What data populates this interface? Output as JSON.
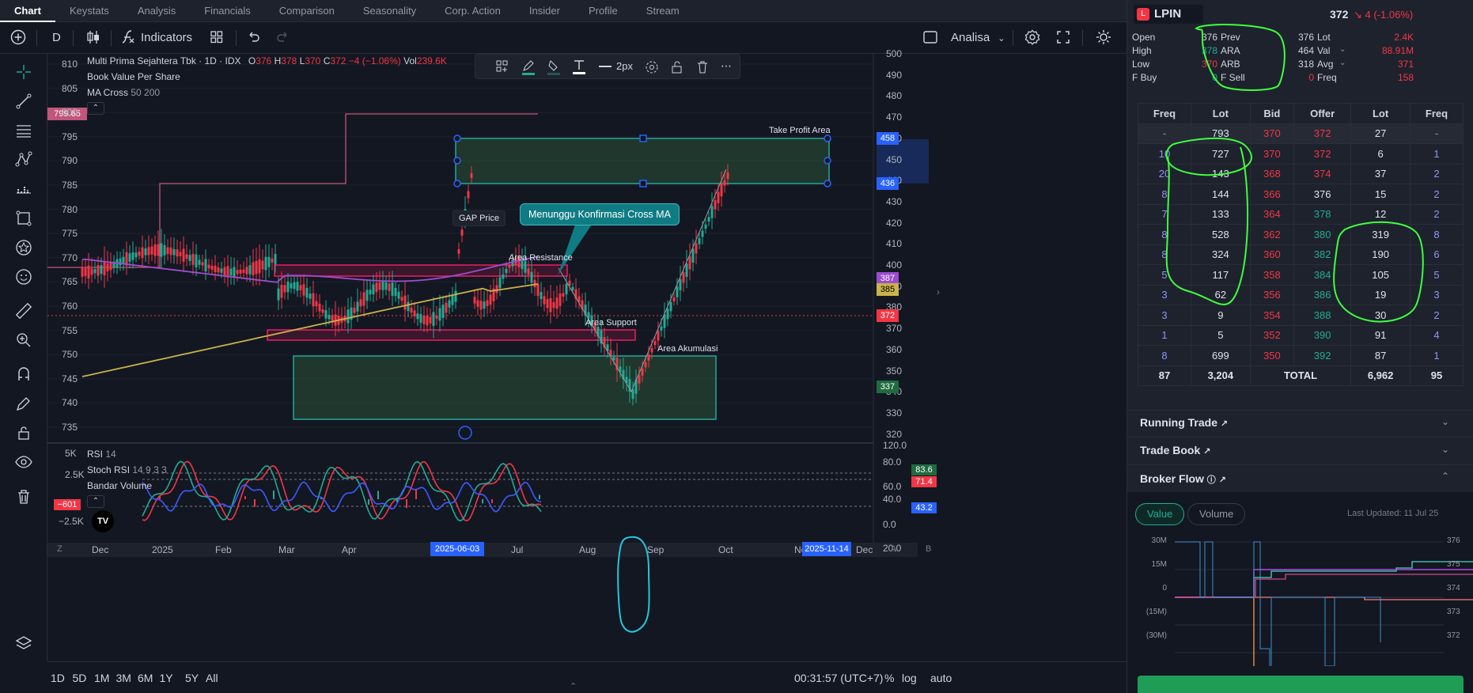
{
  "tabs": [
    "Chart",
    "Keystats",
    "Analysis",
    "Financials",
    "Comparison",
    "Seasonality",
    "Corp. Action",
    "Insider",
    "Profile",
    "Stream"
  ],
  "toolbar": {
    "interval": "D",
    "indicators_label": "Indicators",
    "analisa_label": "Analisa"
  },
  "drawing_toolbar": {
    "width_label": "2px"
  },
  "legend": {
    "title": "Multi Prima Sejahtera Tbk · 1D · IDX",
    "o_label": "O",
    "o": "376",
    "h_label": "H",
    "h": "378",
    "l_label": "L",
    "l": "370",
    "c_label": "C",
    "c": "372",
    "chg": "−4 (−1.06%)",
    "vol_label": "Vol",
    "vol": "239.6K",
    "ind1": "Book Value Per Share",
    "ind2": "MA Cross",
    "ind2_params": "50 200"
  },
  "lower_legend": {
    "rsi": "RSI",
    "rsi_param": "14",
    "stoch": "Stoch RSI",
    "stoch_params": "14 9 3 3",
    "bandar": "Bandar Volume"
  },
  "annotations": {
    "tp": "Take Profit Area",
    "gap": "GAP Price",
    "callout": "Menunggu Konfirmasi Cross MA",
    "resistance": "Area Resistance",
    "support": "Area Support",
    "akumulasi": "Area Akumulasi"
  },
  "left_axis": [
    "810",
    "805",
    "800",
    "795",
    "790",
    "785",
    "780",
    "775",
    "770",
    "765",
    "760",
    "755",
    "750",
    "745",
    "740",
    "735"
  ],
  "left_badge": "799.65",
  "right_axis": [
    "500",
    "490",
    "480",
    "470",
    "460",
    "450",
    "440",
    "430",
    "420",
    "410",
    "400",
    "390",
    "380",
    "370",
    "360",
    "350",
    "340",
    "330",
    "320"
  ],
  "right_badges": {
    "b458": "458",
    "b436": "436",
    "b387": "387",
    "b385": "385",
    "b372": "372",
    "b337": "337"
  },
  "lower_left_axis": [
    "5K",
    "2.5K",
    "0",
    "−2.5K"
  ],
  "lower_left_badge": "−601",
  "lower_right_axis": [
    "120.0",
    "80.0",
    "60.0",
    "40.0",
    "0.0",
    "20.0"
  ],
  "lower_right_badges": {
    "a": "83.6",
    "b": "71.4",
    "c": "43.2"
  },
  "time_axis": [
    "Dec",
    "2025",
    "Feb",
    "Mar",
    "Apr",
    "Jul",
    "Aug",
    "Sep",
    "Oct",
    "No",
    "Dec"
  ],
  "time_badges": {
    "a": "2025-06-03",
    "b": "2025-11-14"
  },
  "bottom": {
    "ranges": [
      "1D",
      "5D",
      "1M",
      "3M",
      "6M",
      "1Y",
      "5Y",
      "All"
    ],
    "clock": "00:31:57 (UTC+7)",
    "pct": "%",
    "log": "log",
    "auto": "auto"
  },
  "rp": {
    "ticker": "LPIN",
    "price": "372",
    "change": "4 (-1.06%)",
    "stats": [
      [
        "Open",
        "376",
        "Prev",
        "376",
        "Lot",
        "2.4K"
      ],
      [
        "High",
        "378",
        "ARA",
        "464",
        "Val",
        "88.91M"
      ],
      [
        "Low",
        "370",
        "ARB",
        "318",
        "Avg",
        "371"
      ],
      [
        "F Buy",
        "0",
        "F Sell",
        "0",
        "Freq",
        "158"
      ]
    ],
    "ob_headers": [
      "Freq",
      "Lot",
      "Bid",
      "Offer",
      "Lot",
      "Freq"
    ],
    "ob_rows": [
      [
        "-",
        "793",
        "370",
        "372",
        "27",
        "-"
      ],
      [
        "10",
        "727",
        "370",
        "372",
        "6",
        "1"
      ],
      [
        "20",
        "143",
        "368",
        "374",
        "37",
        "2"
      ],
      [
        "8",
        "144",
        "366",
        "376",
        "15",
        "2"
      ],
      [
        "7",
        "133",
        "364",
        "378",
        "12",
        "2"
      ],
      [
        "8",
        "528",
        "362",
        "380",
        "319",
        "8"
      ],
      [
        "8",
        "324",
        "360",
        "382",
        "190",
        "6"
      ],
      [
        "5",
        "117",
        "358",
        "384",
        "105",
        "5"
      ],
      [
        "3",
        "62",
        "356",
        "386",
        "19",
        "3"
      ],
      [
        "3",
        "9",
        "354",
        "388",
        "30",
        "2"
      ],
      [
        "1",
        "5",
        "352",
        "390",
        "91",
        "4"
      ],
      [
        "8",
        "699",
        "350",
        "392",
        "87",
        "1"
      ]
    ],
    "ob_total": [
      "87",
      "3,204",
      "TOTAL",
      "6,962",
      "95"
    ],
    "running_trade": "Running Trade",
    "trade_book": "Trade Book",
    "broker_flow": "Broker Flow",
    "tab_value": "Value",
    "tab_volume": "Volume",
    "last_updated": "Last Updated: 11 Jul 25",
    "bf_left_axis": [
      "30M",
      "15M",
      "0",
      "(15M)",
      "(30M)"
    ],
    "bf_right_axis": [
      "376",
      "375",
      "374",
      "373",
      "372"
    ]
  },
  "colors": {
    "bg": "#131722",
    "green": "#22ab94",
    "red": "#f23645",
    "accent": "#2962ff",
    "ma50": "#9c4dcc",
    "ma200": "#c9b34a",
    "bvps": "#c2557a"
  }
}
